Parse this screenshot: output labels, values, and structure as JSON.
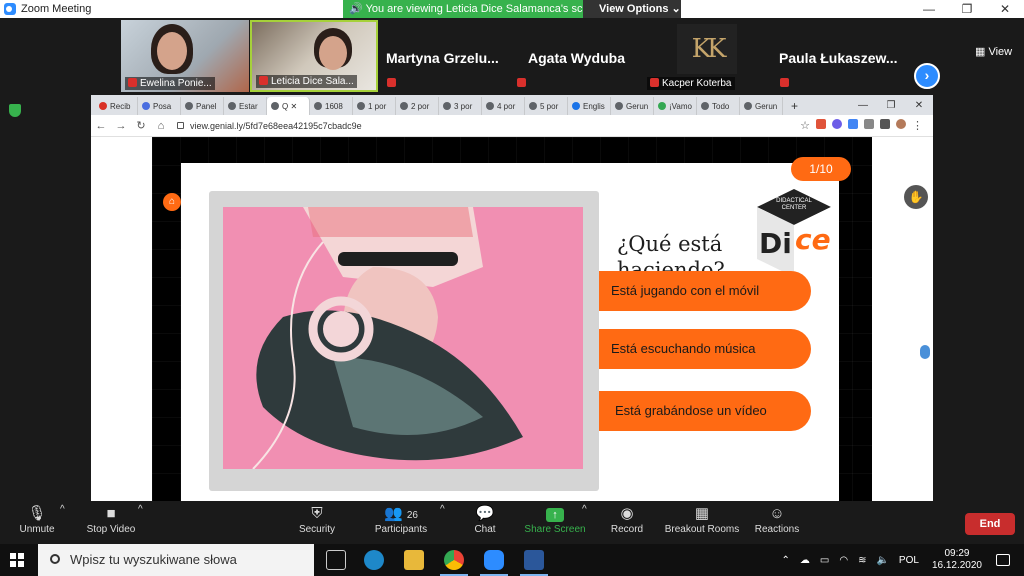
{
  "zoom": {
    "window_title": "Zoom Meeting",
    "share_banner": "You are viewing Leticia Dice Salamanca's screen",
    "view_options": "View Options",
    "view_label": "View",
    "win_controls": [
      "—",
      "❐",
      "✕"
    ]
  },
  "participants": [
    {
      "name": "Ewelina Ponie..."
    },
    {
      "name": "Leticia Dice Sala..."
    },
    {
      "name": "Martyna  Grzelu..."
    },
    {
      "name": "Agata Wyduba"
    },
    {
      "name": "Kacper Koterba"
    },
    {
      "name": "Paula  Łukaszew..."
    }
  ],
  "browser": {
    "tabs": [
      "Recib",
      "Posa",
      "Panel",
      "Estar",
      "Q",
      "1608",
      "1 por",
      "2 por",
      "3 por",
      "4 por",
      "5 por",
      "Englis",
      "Gerun",
      "¡Vamo",
      "Todo",
      "Gerun"
    ],
    "active_tab_index": 4,
    "url": "view.genial.ly/5fd7e68eea42195c7cbadc9e",
    "new_tab": "+",
    "win_controls": [
      "—",
      "❐",
      "✕"
    ]
  },
  "slide": {
    "counter": "1/10",
    "question": "¿Qué está haciendo?",
    "logo_top": "DIDACTICAL CENTER",
    "logo_di": "Di",
    "logo_ce": "ce",
    "answers": [
      "Está jugando con el móvil",
      "Está escuchando música",
      "Está grabándose un vídeo"
    ]
  },
  "toolbar": {
    "unmute": "Unmute",
    "stop_video": "Stop Video",
    "security": "Security",
    "participants": "Participants",
    "participants_count": "26",
    "chat": "Chat",
    "share_screen": "Share Screen",
    "record": "Record",
    "breakout_rooms": "Breakout Rooms",
    "reactions": "Reactions",
    "end": "End"
  },
  "taskbar": {
    "search_placeholder": "Wpisz tu wyszukiwane słowa",
    "language": "POL",
    "time": "09:29",
    "date": "16.12.2020"
  },
  "colors": {
    "zoom_blue": "#2D8CFF",
    "share_green": "#37b24d",
    "accent_orange": "#ff6a13",
    "end_red": "#c82d2d"
  }
}
